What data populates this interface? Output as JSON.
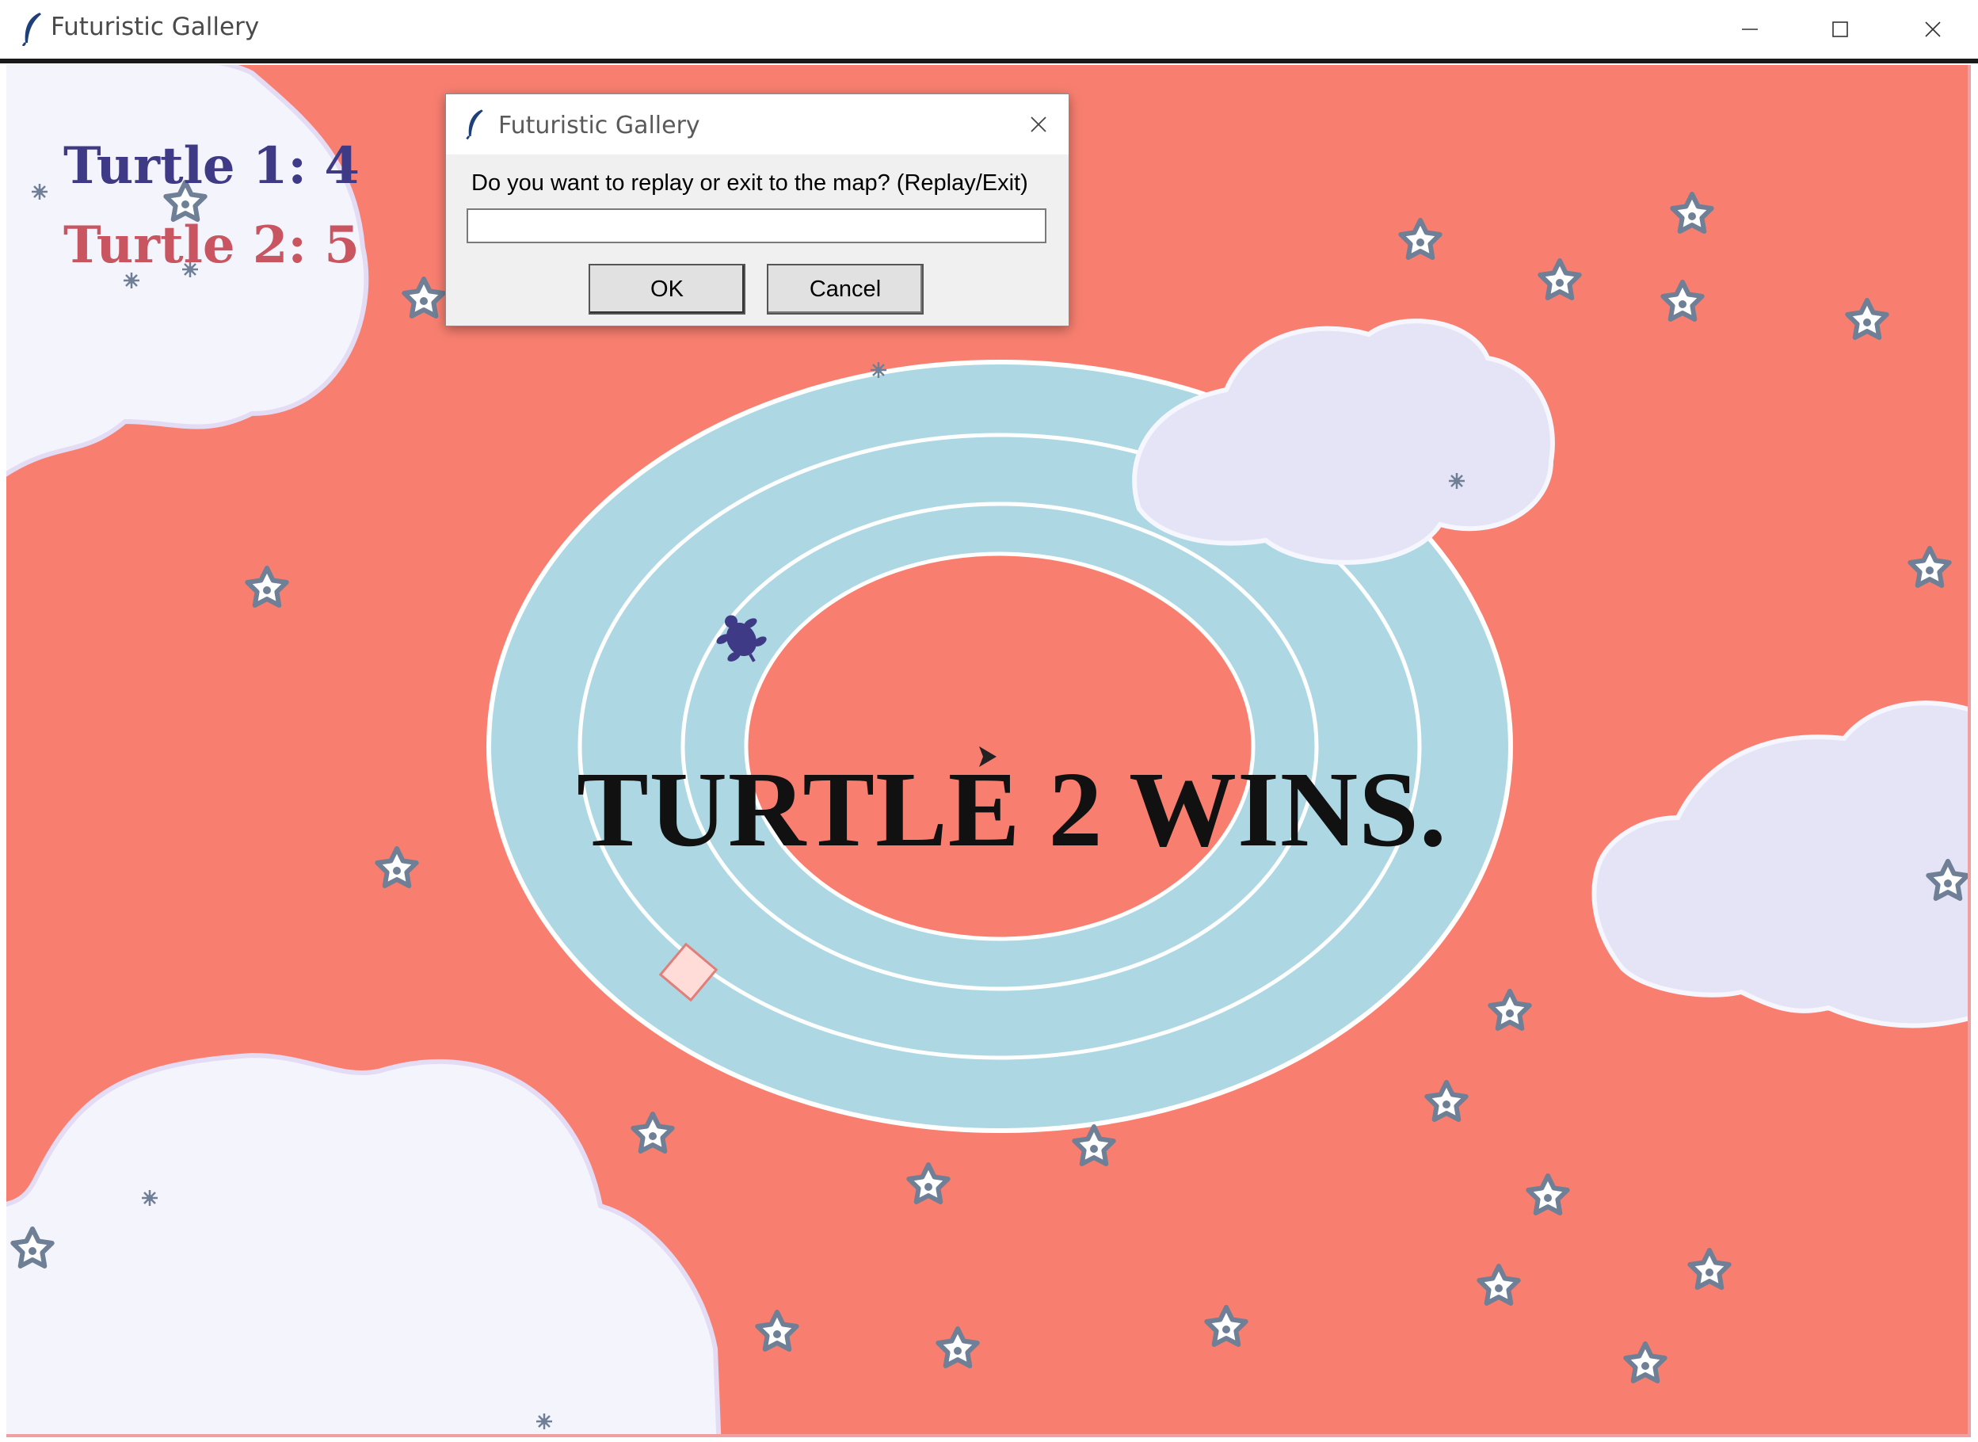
{
  "window": {
    "title": "Futuristic Gallery",
    "controls": [
      "minimize",
      "maximize",
      "close"
    ]
  },
  "scoreboard": {
    "turtle1": "Turtle 1: 4",
    "turtle2": "Turtle 2: 5",
    "turtle1_color": "#3f3a85",
    "turtle2_color": "#c85560"
  },
  "game": {
    "result_text": "TURTLE 2 WINS.",
    "background_color": "#f87f70",
    "track_color": "#add8e3",
    "cloud_color": "#f4f4fc",
    "star_color": "#6f7f95",
    "turtle1_sprite": "turtle-sprite",
    "obstacle": "pink-diamond"
  },
  "dialog": {
    "title": "Futuristic Gallery",
    "prompt": "Do you want to replay or exit to the map? (Replay/Exit)",
    "input_value": "",
    "ok_label": "OK",
    "cancel_label": "Cancel"
  }
}
